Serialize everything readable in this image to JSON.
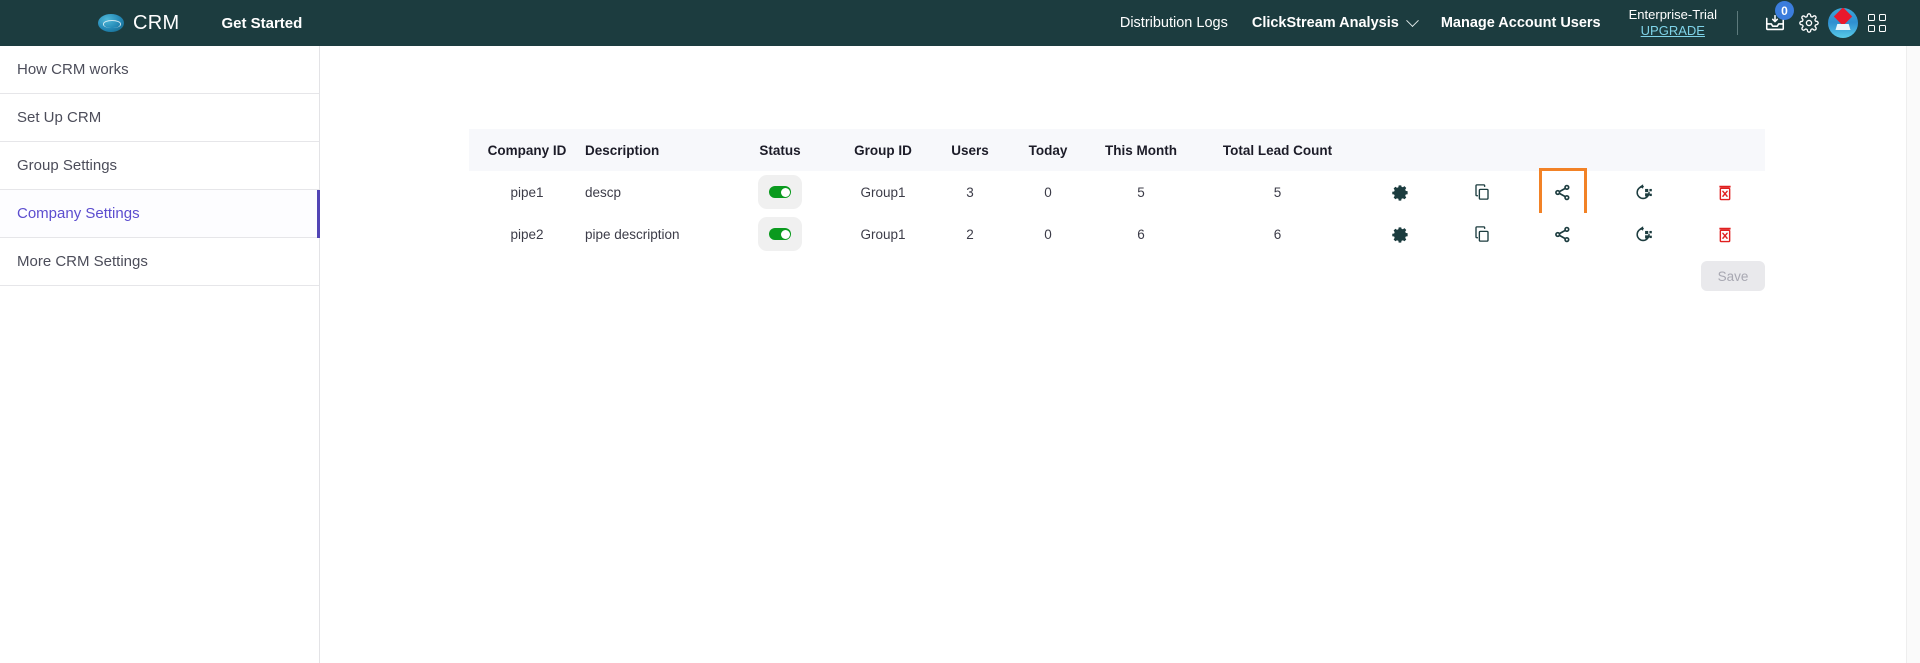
{
  "topbar": {
    "brand_logo_icon": "crm-cloud-icon",
    "brand_name": "CRM",
    "get_started": "Get Started",
    "nav": [
      {
        "label": "Distribution Logs",
        "bold": false,
        "caret": false
      },
      {
        "label": "ClickStream Analysis",
        "bold": true,
        "caret": true
      },
      {
        "label": "Manage Account Users",
        "bold": true,
        "caret": false
      }
    ],
    "trial": {
      "plan": "Enterprise-Trial",
      "upgrade": "UPGRADE"
    },
    "icons": {
      "inbox": "inbox-download-icon",
      "inbox_badge": "0",
      "settings": "gear-icon",
      "app_logo": "zoho-logo-icon",
      "apps_grid": "apps-grid-icon"
    },
    "colors": {
      "bar_bg": "#1c3c3f",
      "badge": "#3b7ddd",
      "upgrade_link": "#7fd3e8"
    }
  },
  "sidebar": {
    "items": [
      {
        "label": "How CRM works",
        "active": false
      },
      {
        "label": "Set Up CRM",
        "active": false
      },
      {
        "label": "Group Settings",
        "active": false
      },
      {
        "label": "Company Settings",
        "active": true
      },
      {
        "label": "More CRM Settings",
        "active": false
      }
    ],
    "active_color": "#5c4dcf"
  },
  "table": {
    "columns": [
      "Company ID",
      "Description",
      "Status",
      "Group ID",
      "Users",
      "Today",
      "This Month",
      "Total Lead Count"
    ],
    "rows": [
      {
        "company_id": "pipe1",
        "description": "descp",
        "status_on": true,
        "group_id": "Group1",
        "users": "3",
        "today": "0",
        "this_month": "5",
        "total_lead_count": "5",
        "actions": [
          {
            "name": "settings-icon",
            "highlighted": false
          },
          {
            "name": "copy-icon",
            "highlighted": false
          },
          {
            "name": "share-icon",
            "highlighted": true
          },
          {
            "name": "restore-icon",
            "highlighted": false
          },
          {
            "name": "delete-icon",
            "highlighted": false
          }
        ]
      },
      {
        "company_id": "pipe2",
        "description": "pipe description",
        "status_on": true,
        "group_id": "Group1",
        "users": "2",
        "today": "0",
        "this_month": "6",
        "total_lead_count": "6",
        "actions": [
          {
            "name": "settings-icon",
            "highlighted": false
          },
          {
            "name": "copy-icon",
            "highlighted": false
          },
          {
            "name": "share-icon",
            "highlighted": false
          },
          {
            "name": "restore-icon",
            "highlighted": false
          },
          {
            "name": "delete-icon",
            "highlighted": false
          }
        ]
      }
    ],
    "header_bg": "#f7f8fb",
    "toggle_on_color": "#0a9a1e",
    "delete_icon_color": "#e02020",
    "highlight_color": "#f28226"
  },
  "footer_actions": {
    "save_label": "Save",
    "save_disabled": true
  }
}
